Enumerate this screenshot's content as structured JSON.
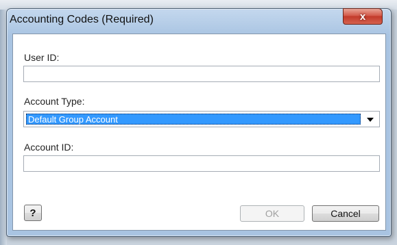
{
  "dialog": {
    "title": "Accounting Codes (Required)",
    "close_label": "x"
  },
  "form": {
    "user_id": {
      "label": "User ID:",
      "value": ""
    },
    "account_type": {
      "label": "Account Type:",
      "selected": "Default Group Account"
    },
    "account_id": {
      "label": "Account ID:",
      "value": ""
    }
  },
  "buttons": {
    "help_label": "?",
    "ok_label": "OK",
    "cancel_label": "Cancel"
  }
}
